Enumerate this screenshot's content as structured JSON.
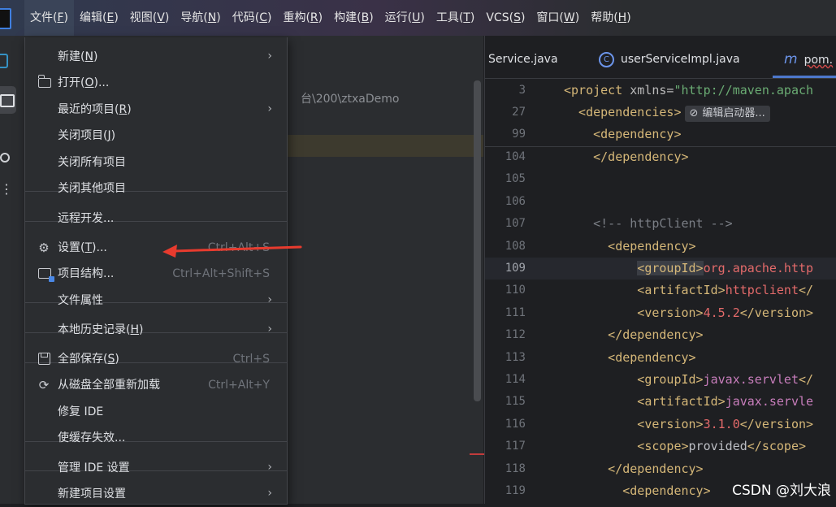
{
  "menubar": {
    "items": [
      {
        "text": "文件(",
        "key": "F",
        "end": ")"
      },
      {
        "text": "编辑(",
        "key": "E",
        "end": ")"
      },
      {
        "text": "视图(",
        "key": "V",
        "end": ")"
      },
      {
        "text": "导航(",
        "key": "N",
        "end": ")"
      },
      {
        "text": "代码(",
        "key": "C",
        "end": ")"
      },
      {
        "text": "重构(",
        "key": "R",
        "end": ")"
      },
      {
        "text": "构建(",
        "key": "B",
        "end": ")"
      },
      {
        "text": "运行(",
        "key": "U",
        "end": ")"
      },
      {
        "text": "工具(",
        "key": "T",
        "end": ")"
      },
      {
        "text": "VCS(",
        "key": "S",
        "end": ")"
      },
      {
        "text": "窗口(",
        "key": "W",
        "end": ")"
      },
      {
        "text": "帮助(",
        "key": "H",
        "end": ")"
      }
    ]
  },
  "project": {
    "path": "台\\200\\ztxaDemo"
  },
  "file_menu": {
    "items": [
      {
        "pre": "新建(",
        "key": "N",
        "post": ")",
        "arrow": "›"
      },
      {
        "pre": "打开(",
        "key": "O",
        "post": ")..."
      },
      {
        "pre": "最近的项目(",
        "key": "R",
        "post": ")",
        "arrow": "›"
      },
      {
        "pre": "关闭项目(",
        "key": "J",
        "post": ")"
      },
      {
        "pre": "关闭所有项目",
        "key": "",
        "post": ""
      },
      {
        "pre": "关闭其他项目",
        "key": "",
        "post": ""
      },
      {
        "pre": "远程开发...",
        "key": "",
        "post": ""
      },
      {
        "pre": "设置(",
        "key": "T",
        "post": ")...",
        "shortcut": "Ctrl+Alt+S"
      },
      {
        "pre": "项目结构...",
        "key": "",
        "post": "",
        "shortcut": "Ctrl+Alt+Shift+S"
      },
      {
        "pre": "文件属性",
        "key": "",
        "post": "",
        "arrow": "›"
      },
      {
        "pre": "本地历史记录(",
        "key": "H",
        "post": ")",
        "arrow": "›"
      },
      {
        "pre": "全部保存(",
        "key": "S",
        "post": ")",
        "shortcut": "Ctrl+S"
      },
      {
        "pre": "从磁盘全部重新加载",
        "key": "",
        "post": "",
        "shortcut": "Ctrl+Alt+Y"
      },
      {
        "pre": "修复 IDE",
        "key": "",
        "post": ""
      },
      {
        "pre": "使缓存失效...",
        "key": "",
        "post": ""
      },
      {
        "pre": "管理 IDE 设置",
        "key": "",
        "post": "",
        "arrow": "›"
      },
      {
        "pre": "新建项目设置",
        "key": "",
        "post": "",
        "arrow": "›"
      }
    ]
  },
  "editor": {
    "tabs": [
      "Service.java",
      "userServiceImpl.java",
      "pom."
    ],
    "sticky": [
      {
        "ln": "3",
        "parts": [
          [
            "t-tag",
            "<project"
          ],
          [
            "t-attr",
            " xmlns="
          ],
          [
            "t-str",
            "\"http://maven.apach"
          ]
        ]
      },
      {
        "ln": "27",
        "parts": [
          [
            "t-tag",
            "  <dependencies>"
          ]
        ],
        "hint": "编辑启动器..."
      },
      {
        "ln": "99",
        "parts": [
          [
            "t-tag",
            "    <dependency>"
          ]
        ]
      }
    ],
    "lines": [
      {
        "ln": "104",
        "parts": [
          [
            "t-tag",
            "    </dependency>"
          ]
        ]
      },
      {
        "ln": "105",
        "parts": []
      },
      {
        "ln": "106",
        "parts": []
      },
      {
        "ln": "107",
        "parts": [
          [
            "t-com",
            "    <!-- httpClient -->"
          ]
        ]
      },
      {
        "ln": "108",
        "parts": [
          [
            "t-tag",
            "      <dependency>"
          ]
        ]
      },
      {
        "ln": "109",
        "current": true,
        "parts": [
          [
            "t-plain",
            "          "
          ],
          [
            "t-tag hl",
            "<groupId>"
          ],
          [
            "t-red",
            "org.apache.http"
          ]
        ]
      },
      {
        "ln": "110",
        "parts": [
          [
            "t-tag",
            "          <artifactId>"
          ],
          [
            "t-red",
            "httpclient"
          ],
          [
            "t-tag",
            "</"
          ]
        ]
      },
      {
        "ln": "111",
        "parts": [
          [
            "t-tag",
            "          <version>"
          ],
          [
            "t-red",
            "4.5.2"
          ],
          [
            "t-tag",
            "</version>"
          ]
        ]
      },
      {
        "ln": "112",
        "parts": [
          [
            "t-tag",
            "      </dependency>"
          ]
        ]
      },
      {
        "ln": "113",
        "parts": [
          [
            "t-tag",
            "      <dependency>"
          ]
        ]
      },
      {
        "ln": "114",
        "parts": [
          [
            "t-tag",
            "          <groupId>"
          ],
          [
            "t-val",
            "javax.servlet"
          ],
          [
            "t-tag",
            "</"
          ]
        ]
      },
      {
        "ln": "115",
        "parts": [
          [
            "t-tag",
            "          <artifactId>"
          ],
          [
            "t-val",
            "javax.servle"
          ]
        ]
      },
      {
        "ln": "116",
        "parts": [
          [
            "t-tag",
            "          <version>"
          ],
          [
            "t-red",
            "3.1.0"
          ],
          [
            "t-tag",
            "</version>"
          ]
        ]
      },
      {
        "ln": "117",
        "parts": [
          [
            "t-tag",
            "          <scope>"
          ],
          [
            "t-plain",
            "provided"
          ],
          [
            "t-tag",
            "</scope>"
          ]
        ]
      },
      {
        "ln": "118",
        "parts": [
          [
            "t-tag",
            "      </dependency>"
          ]
        ]
      },
      {
        "ln": "119",
        "parts": [
          [
            "t-tag",
            "        <dependency>"
          ]
        ]
      }
    ]
  },
  "watermark": "CSDN @刘大浪"
}
